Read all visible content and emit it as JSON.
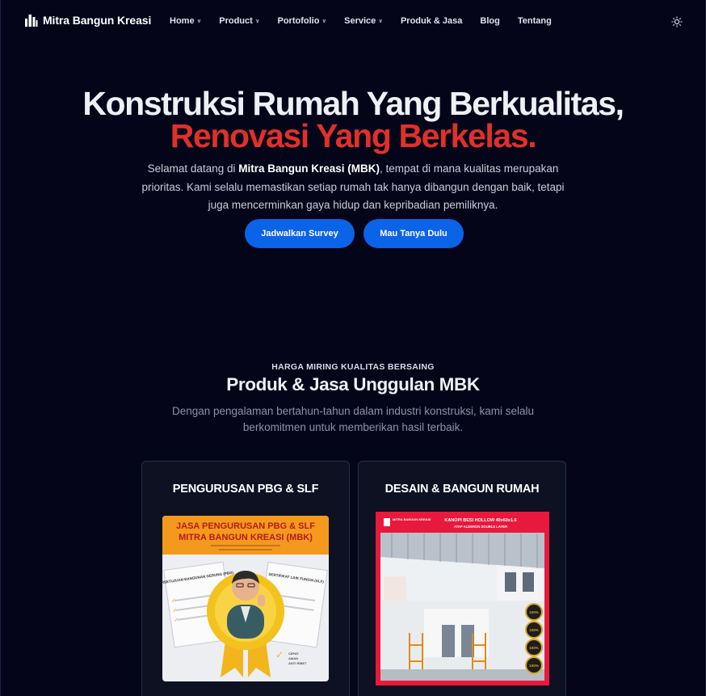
{
  "nav": {
    "brand": "Mitra Bangun Kreasi",
    "items": [
      {
        "label": "Home",
        "dropdown": true
      },
      {
        "label": "Product",
        "dropdown": true
      },
      {
        "label": "Portofolio",
        "dropdown": true
      },
      {
        "label": "Service",
        "dropdown": true
      },
      {
        "label": "Produk & Jasa",
        "dropdown": false
      },
      {
        "label": "Blog",
        "dropdown": false
      },
      {
        "label": "Tentang",
        "dropdown": false
      }
    ],
    "theme_icon": "sun-icon"
  },
  "hero": {
    "title_line1": "Konstruksi Rumah Yang Berkualitas,",
    "title_line2": "Renovasi Yang Berkelas.",
    "desc_before": "Selamat datang di ",
    "desc_bold": "Mitra Bangun Kreasi (MBK)",
    "desc_after": ", tempat di mana kualitas merupakan prioritas. Kami selalu memastikan setiap rumah tak hanya dibangun dengan baik, tetapi juga mencerminkan gaya hidup dan kepribadian pemiliknya.",
    "button_primary": "Jadwalkan Survey",
    "button_secondary": "Mau Tanya Dulu"
  },
  "section": {
    "eyebrow": "HARGA MIRING KUALITAS BERSAING",
    "title": "Produk & Jasa Unggulan MBK",
    "desc": "Dengan pengalaman bertahun-tahun dalam industri konstruksi, kami selalu berkomitmen untuk memberikan hasil terbaik."
  },
  "cards": [
    {
      "title": "PENGURUSAN PBG & SLF",
      "image": {
        "headline1": "JASA PENGURUSAN PBG & SLF",
        "headline2": "MITRA BANGUN KREASI (MBK)",
        "doc_left": "PERSETUJUAN BANGUNAN GEDUNG (PBG)",
        "doc_right": "SERTIFIKAT LAIK FUNGSI (SLF)",
        "checks": [
          "CEPAT",
          "AMAN",
          "ANTI RIBET"
        ]
      }
    },
    {
      "title": "DESAIN & BANGUN RUMAH",
      "image": {
        "logo_text": "MITRA BANGUN KREASI",
        "caption1": "KANOPI BESI HOLLOW 40x60x1.6",
        "caption2": "ATAP ALDERON DOUBLE LAYER",
        "badges": [
          "100%",
          "100%",
          "100%",
          "100%"
        ]
      }
    }
  ],
  "colors": {
    "background": "#050519",
    "accent_red": "#e0302b",
    "button_blue": "#0b63e8",
    "card_border": "#2a3044",
    "promo_orange": "#f39a1e",
    "promo_frame_red": "#e8193c"
  }
}
